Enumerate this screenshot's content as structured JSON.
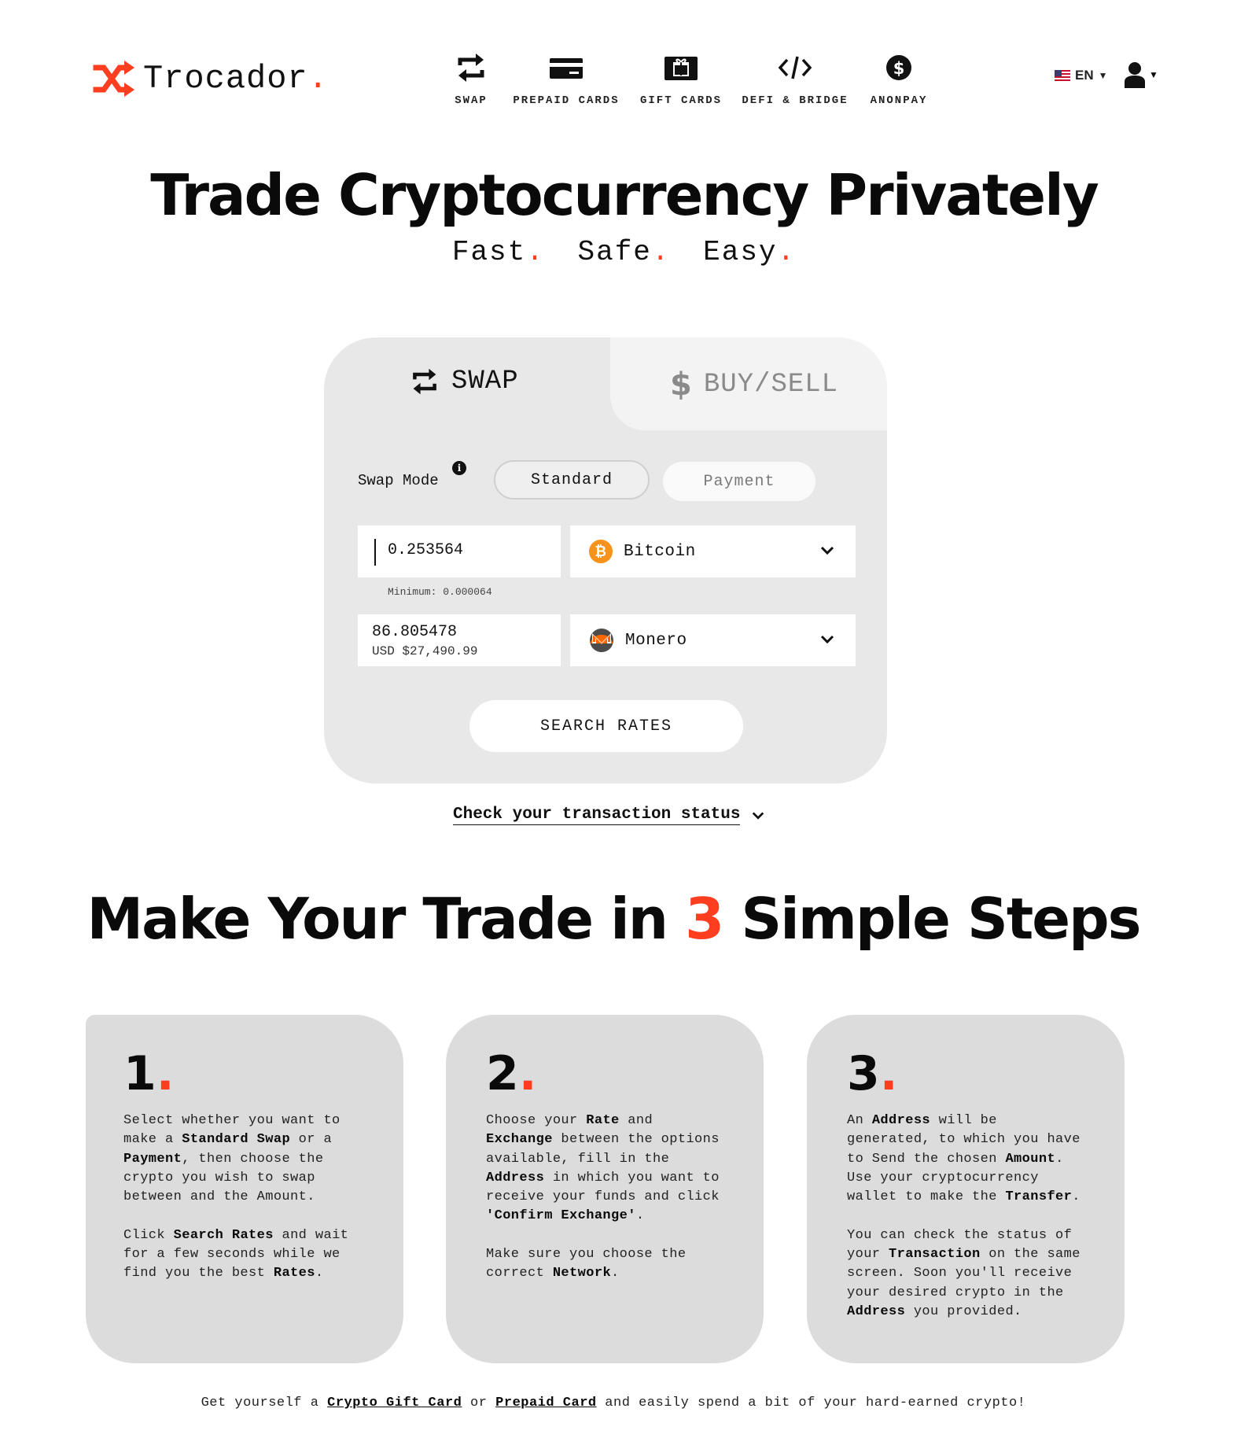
{
  "brand": {
    "name": "Trocador",
    "dot": ".",
    "accent_color": "#ff3d1f"
  },
  "nav": [
    {
      "label": "SWAP",
      "icon": "swap-icon"
    },
    {
      "label": "PREPAID CARDS",
      "icon": "card-icon"
    },
    {
      "label": "GIFT CARDS",
      "icon": "gift-icon"
    },
    {
      "label": "DEFI & BRIDGE",
      "icon": "code-icon"
    },
    {
      "label": "ANONPAY",
      "icon": "dollar-coin-icon"
    }
  ],
  "language": {
    "code": "EN",
    "flag": "us-flag-icon"
  },
  "account": {
    "icon": "user-icon"
  },
  "hero": {
    "title": "Trade Cryptocurrency Privately",
    "sub": [
      "Fast",
      "Safe",
      "Easy"
    ],
    "dot": "."
  },
  "widget": {
    "tabs": [
      {
        "label": "SWAP",
        "icon": "swap-icon",
        "active": true
      },
      {
        "label": "BUY/SELL",
        "icon": "dollar-icon",
        "active": false
      }
    ],
    "swap_mode_label": "Swap Mode",
    "info_icon": "i",
    "modes": [
      {
        "label": "Standard",
        "selected": true
      },
      {
        "label": "Payment",
        "selected": false
      }
    ],
    "from": {
      "amount": "0.253564",
      "minimum": "Minimum: 0.000064",
      "coin": "Bitcoin",
      "coin_icon": "bitcoin-icon",
      "coin_symbol": "₿"
    },
    "to": {
      "amount": "86.805478",
      "usd": "USD $27,490.99",
      "coin": "Monero",
      "coin_icon": "monero-icon"
    },
    "search_button": "SEARCH RATES"
  },
  "check_status": "Check your transaction status",
  "steps": {
    "title_before": "Make Your Trade in ",
    "title_number": "3",
    "title_after": " Simple Steps",
    "cards": [
      {
        "number": "1",
        "dot": ".",
        "p1": [
          "Select whether you want to make a ",
          "Standard Swap",
          " or a ",
          "Payment",
          ", then choose the crypto you wish to swap between and the Amount."
        ],
        "p2": [
          "Click ",
          "Search Rates",
          " and wait for a few seconds while we find you the best ",
          "Rates",
          "."
        ]
      },
      {
        "number": "2",
        "dot": ".",
        "p1": [
          "Choose your ",
          "Rate",
          " and ",
          "Exchange",
          " between the options available, fill in the ",
          "Address",
          " in which you want to receive your funds and click ",
          "'Confirm Exchange'",
          "."
        ],
        "p2": [
          "Make sure you choose the correct ",
          "Network",
          "."
        ]
      },
      {
        "number": "3",
        "dot": ".",
        "p1": [
          "An ",
          "Address",
          " will be generated, to which you have to Send the chosen ",
          "Amount",
          ". Use your cryptocurrency wallet to make the ",
          "Transfer",
          "."
        ],
        "p2": [
          "You can check the status of your ",
          "Transaction",
          " on the same screen. Soon you'll receive your desired crypto in the ",
          "Address",
          " you provided."
        ]
      }
    ]
  },
  "footer": {
    "t1": "Get yourself a ",
    "link1": "Crypto Gift Card",
    "t2": " or ",
    "link2": "Prepaid Card",
    "t3": " and easily spend a bit of your hard-earned crypto!"
  }
}
